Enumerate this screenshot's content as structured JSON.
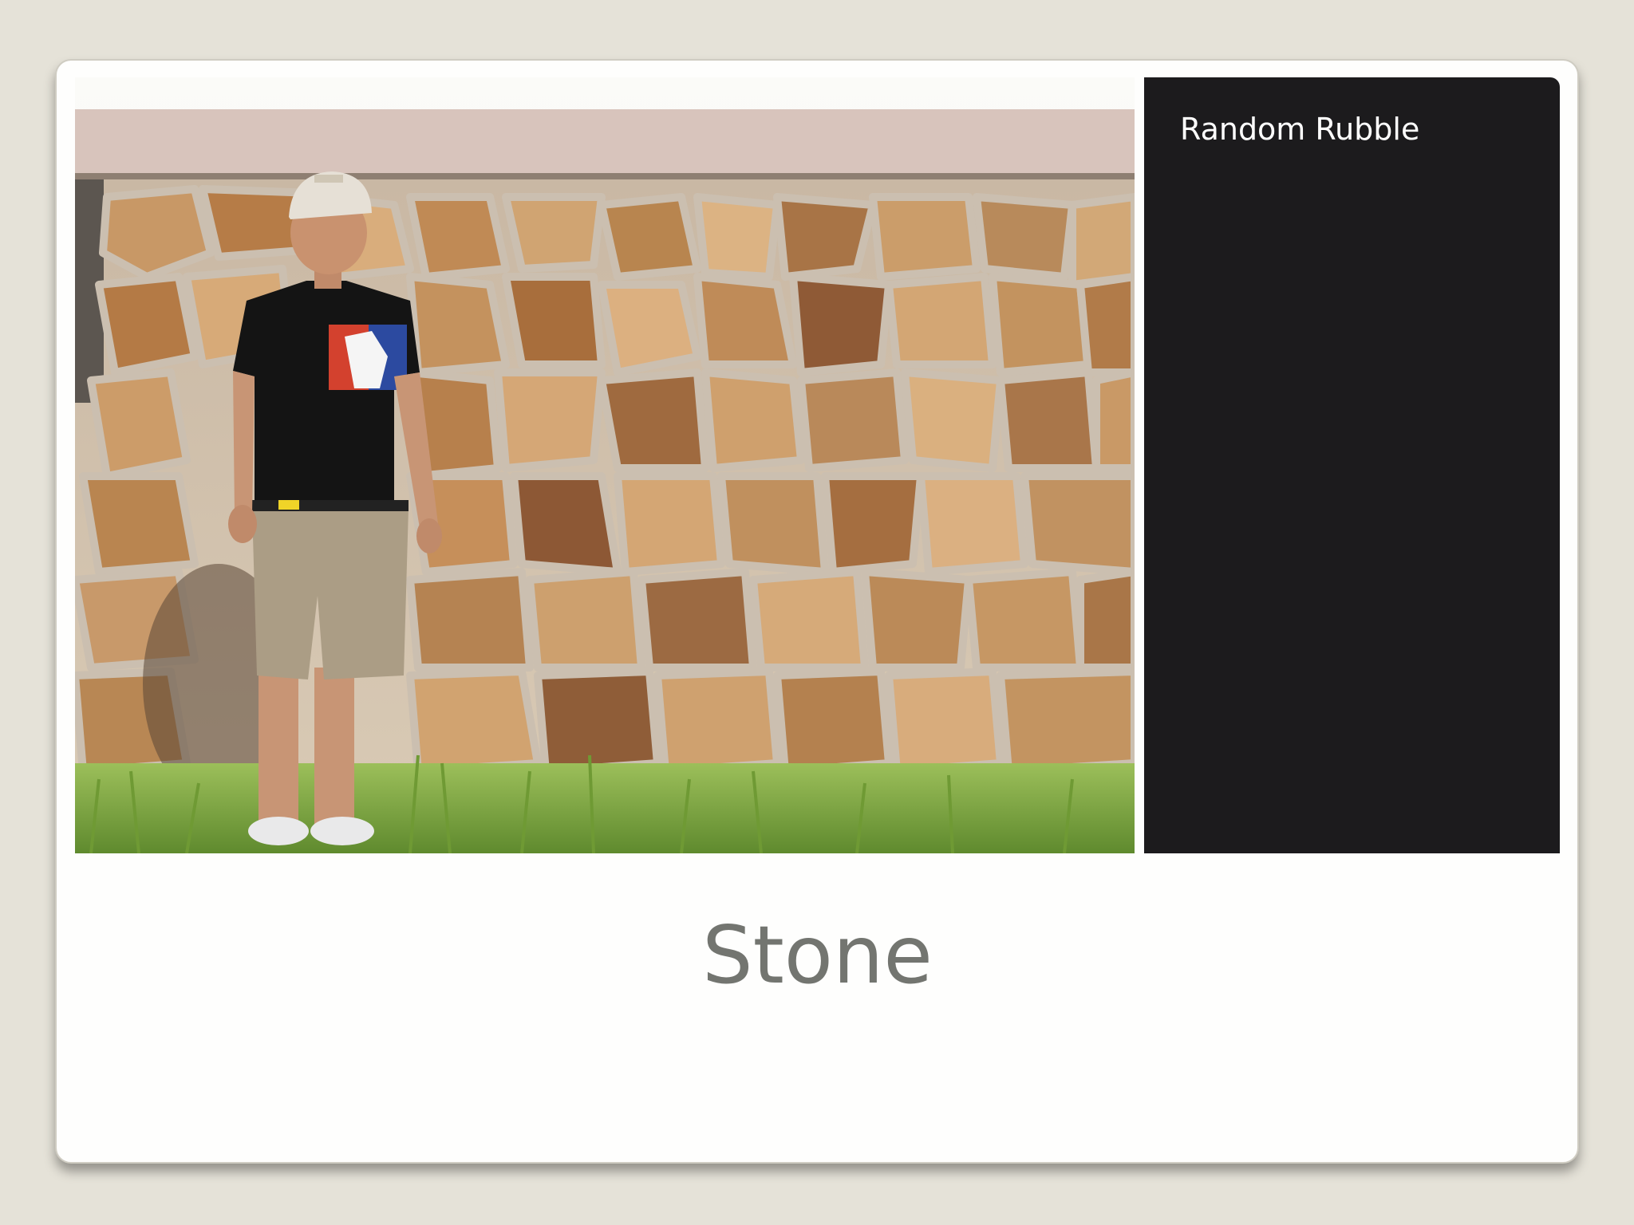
{
  "slide": {
    "title": "Stone",
    "caption": "Random Rubble"
  },
  "photo": {
    "alt": "Person standing in front of a random rubble stone wall"
  },
  "colors": {
    "background": "#e5e2d8",
    "card": "#fefefd",
    "caption_panel": "#1c1b1d",
    "caption_text": "#ffffff",
    "title_text": "#737570"
  }
}
